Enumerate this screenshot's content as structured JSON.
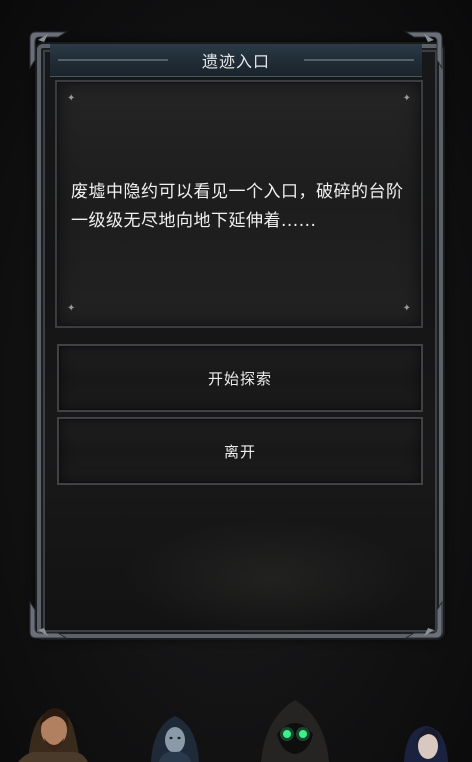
{
  "dialog": {
    "title": "遗迹入口",
    "description": "废墟中隐约可以看见一个入口，破碎的台阶一级级无尽地向地下延伸着......",
    "options": [
      {
        "label": "开始探索"
      },
      {
        "label": "离开"
      }
    ]
  },
  "icons": {
    "frame_corner": "ornate-corner-icon",
    "sparkle": "sparkle-icon"
  },
  "colors": {
    "title_bar": "#1f2b35",
    "frame_border": "#5b6168",
    "panel": "#1d1d1d",
    "text": "#f0f0f0",
    "rogue_eyes": "#3df08a"
  },
  "party": [
    "warrior",
    "hooded-mage",
    "hooded-rogue",
    "priestess"
  ]
}
